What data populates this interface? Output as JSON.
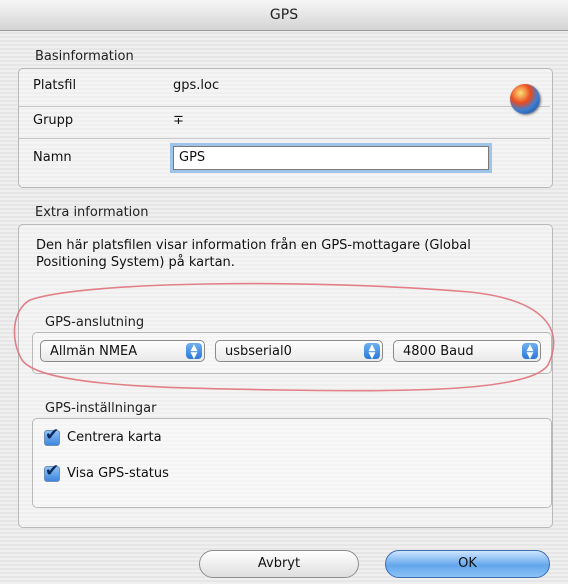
{
  "window": {
    "title": "GPS"
  },
  "basic": {
    "section_title": "Basinformation",
    "file_label": "Platsfil",
    "file_value": "gps.loc",
    "group_label": "Grupp",
    "group_value": "∓",
    "name_label": "Namn",
    "name_value": "GPS"
  },
  "extra": {
    "section_title": "Extra information",
    "description": "Den här platsfilen visar information från en GPS-mottagare (Global Positioning System) på kartan."
  },
  "connection": {
    "title": "GPS-anslutning",
    "protocol": "Allmän NMEA",
    "port": "usbserial0",
    "baud": "4800 Baud"
  },
  "settings": {
    "title": "GPS-inställningar",
    "center_map": "Centrera karta",
    "show_status": "Visa GPS-status"
  },
  "buttons": {
    "cancel": "Avbryt",
    "ok": "OK"
  },
  "colors": {
    "annotation_ring": "#e0737d",
    "accent": "#3d86de"
  }
}
